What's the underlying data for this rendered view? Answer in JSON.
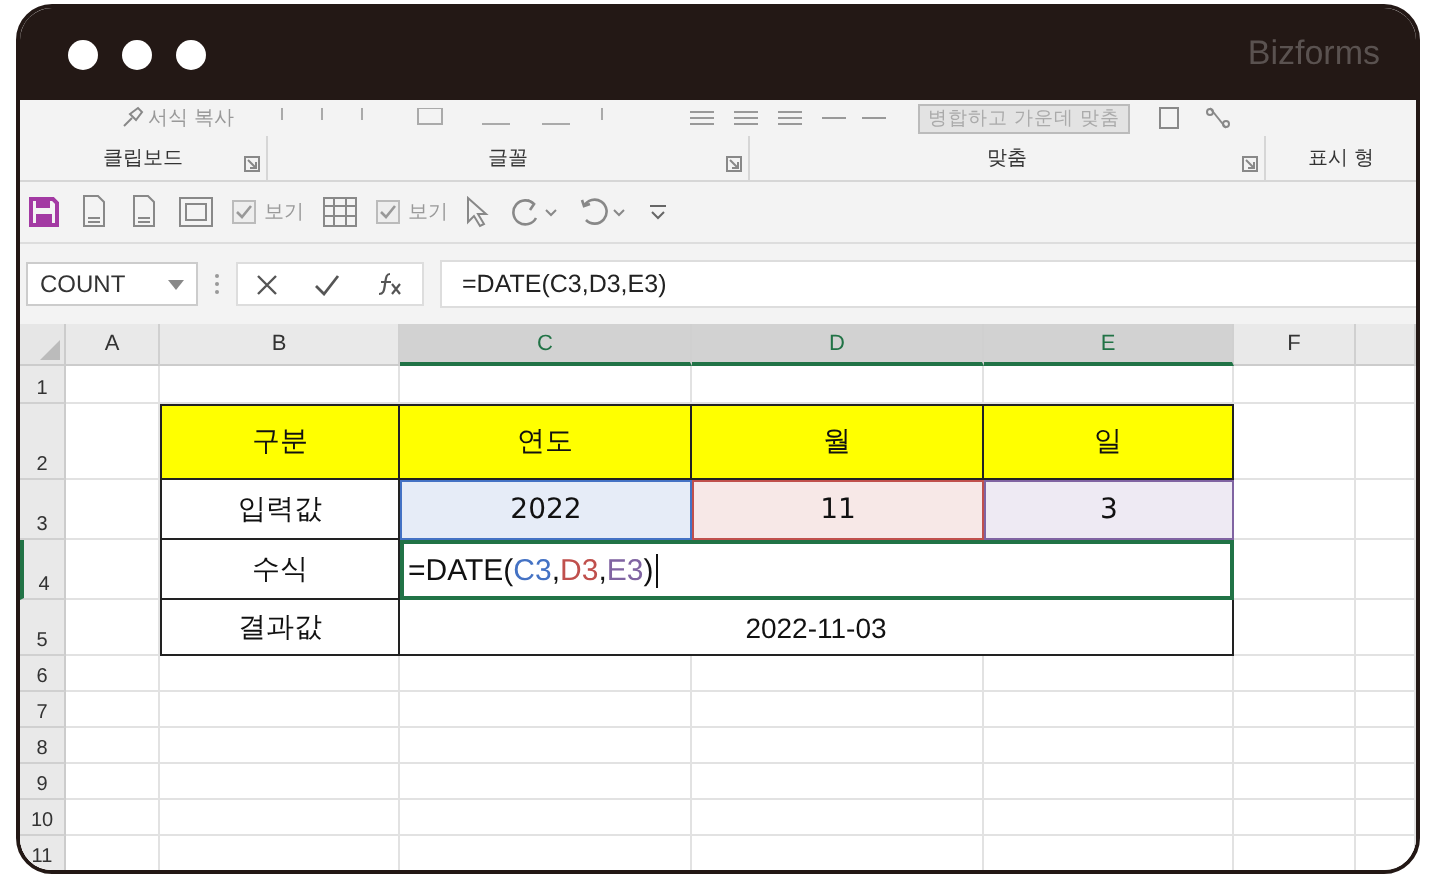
{
  "window": {
    "brand": "Bizforms"
  },
  "ribbon": {
    "top_items": [
      {
        "kind": "brush",
        "label": "서식 복사"
      },
      {
        "kind": "merge",
        "label": "병합하고 가운데 맞춤"
      }
    ],
    "groups": [
      "클립보드",
      "글꼴",
      "맞춤",
      "표시 형"
    ]
  },
  "quick_access": [
    {
      "kind": "save"
    },
    {
      "kind": "doc"
    },
    {
      "kind": "doc"
    },
    {
      "kind": "frame"
    },
    {
      "kind": "check",
      "label": "보기",
      "checked": true
    },
    {
      "kind": "table"
    },
    {
      "kind": "check",
      "label": "보기",
      "checked": true
    },
    {
      "kind": "cursor"
    },
    {
      "kind": "redo"
    },
    {
      "kind": "undo"
    },
    {
      "kind": "more"
    }
  ],
  "formula_bar": {
    "name_box": "COUNT",
    "formula": "=DATE(C3,D3,E3)"
  },
  "sheet": {
    "columns": [
      {
        "label": "A",
        "selected": false
      },
      {
        "label": "B",
        "selected": false
      },
      {
        "label": "C",
        "selected": true
      },
      {
        "label": "D",
        "selected": true
      },
      {
        "label": "E",
        "selected": true
      },
      {
        "label": "F",
        "selected": false
      }
    ],
    "row_numbers": [
      {
        "label": "1",
        "selected": false
      },
      {
        "label": "2",
        "selected": false
      },
      {
        "label": "3",
        "selected": false
      },
      {
        "label": "4",
        "selected": true
      },
      {
        "label": "5",
        "selected": false
      },
      {
        "label": "6",
        "selected": false
      },
      {
        "label": "7",
        "selected": false
      },
      {
        "label": "8",
        "selected": false
      },
      {
        "label": "9",
        "selected": false
      },
      {
        "label": "10",
        "selected": false
      },
      {
        "label": "11",
        "selected": false
      }
    ],
    "table": [
      [
        {
          "kind": "header",
          "text": "구분"
        },
        {
          "kind": "header",
          "text": "연도"
        },
        {
          "kind": "header",
          "text": "월"
        },
        {
          "kind": "header",
          "text": "일"
        }
      ],
      [
        {
          "kind": "label",
          "text": "입력값"
        },
        {
          "kind": "input",
          "text": "2022",
          "color": "#4472c4"
        },
        {
          "kind": "input",
          "text": "11",
          "color": "#c0504d"
        },
        {
          "kind": "input",
          "text": "3",
          "color": "#8064a2"
        }
      ],
      [
        {
          "kind": "label",
          "text": "수식"
        },
        {
          "kind": "editing",
          "merged": true,
          "parts": [
            {
              "text": "=DATE("
            },
            {
              "text": "C3",
              "color": "#4472c4"
            },
            {
              "text": ","
            },
            {
              "text": "D3",
              "color": "#c0504d"
            },
            {
              "text": ","
            },
            {
              "text": "E3",
              "color": "#8064a2"
            },
            {
              "text": ")"
            }
          ]
        }
      ],
      [
        {
          "kind": "label",
          "text": "결과값"
        },
        {
          "kind": "value",
          "merged": true,
          "text": "2022-11-03"
        }
      ]
    ]
  }
}
